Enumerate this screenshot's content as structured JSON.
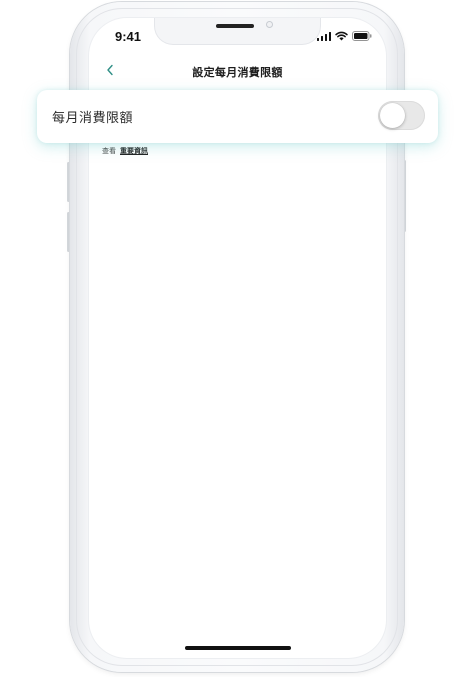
{
  "status_bar": {
    "time": "9:41",
    "icons": [
      "cellular-signal-icon",
      "wifi-icon",
      "battery-icon"
    ]
  },
  "nav": {
    "back_icon": "chevron-left-icon",
    "title": "設定每月消費限額"
  },
  "setting": {
    "label": "每月消費限額",
    "toggle_on": false
  },
  "info": {
    "prefix": "查看",
    "link_label": "重要資訊"
  },
  "colors": {
    "accent": "#2f8f86",
    "card_glow": "#7ccfcf",
    "toggle_off_track": "#e8e8e8"
  }
}
